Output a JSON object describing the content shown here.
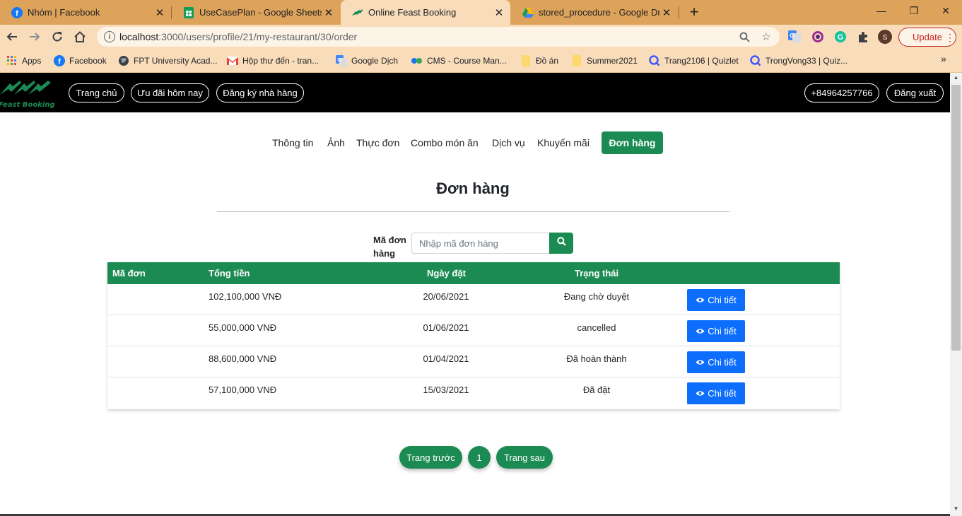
{
  "browser": {
    "tabs": [
      {
        "title": "Nhóm | Facebook",
        "icon": "facebook-icon"
      },
      {
        "title": "UseCasePlan - Google Sheets",
        "icon": "google-sheets-icon"
      },
      {
        "title": "Online Feast Booking",
        "icon": "feast-booking-icon",
        "active": true
      },
      {
        "title": "stored_procedure - Google Drive",
        "icon": "google-drive-icon"
      }
    ],
    "url_host": "localhost",
    "url_path": ":3000/users/profile/21/my-restaurant/30/order",
    "profile_initial": "S",
    "update_label": "Update",
    "bookmarks": [
      {
        "label": "Apps",
        "icon": "apps-grid-icon"
      },
      {
        "label": "Facebook",
        "icon": "facebook-icon"
      },
      {
        "label": "FPT University Acad...",
        "icon": "globe-icon"
      },
      {
        "label": "Hộp thư đến - tran...",
        "icon": "gmail-icon"
      },
      {
        "label": "Google Dịch",
        "icon": "google-translate-icon"
      },
      {
        "label": "CMS - Course Man...",
        "icon": "cms-icon"
      },
      {
        "label": "Đồ án",
        "icon": "folder-icon"
      },
      {
        "label": "Summer2021",
        "icon": "folder-icon"
      },
      {
        "label": "Trang2106 | Quizlet",
        "icon": "quizlet-icon"
      },
      {
        "label": "TrongVong33 | Quiz...",
        "icon": "quizlet-icon"
      }
    ],
    "colors": {
      "tabstrip": "#dea35a",
      "toolbar": "#f9ddbb"
    }
  },
  "site": {
    "logo_text": "Feast Booking",
    "nav": {
      "home": "Trang chủ",
      "deals": "Ưu đãi hôm nay",
      "register": "Đăng ký nhà hàng"
    },
    "phone": "+84964257766",
    "logout": "Đăng xuất",
    "accent_color": "#1b8a53"
  },
  "subnav": {
    "info": "Thông tin",
    "photos": "Ảnh",
    "menu": "Thực đơn",
    "combo": "Combo món ăn",
    "services": "Dịch vụ",
    "promotions": "Khuyến mãi",
    "orders": "Đơn hàng"
  },
  "page": {
    "title": "Đơn hàng",
    "search_label": "Mã đơn hàng",
    "search_placeholder": "Nhập mã đơn hàng"
  },
  "table": {
    "headers": {
      "id": "Mã đơn",
      "total": "Tổng tiền",
      "date": "Ngày đặt",
      "status": "Trạng thái"
    },
    "detail_label": "Chi tiết",
    "rows": [
      {
        "id": "",
        "total": "102,100,000 VNĐ",
        "date": "20/06/2021",
        "status": "Đang chờ duyệt"
      },
      {
        "id": "",
        "total": "55,000,000 VNĐ",
        "date": "01/06/2021",
        "status": "cancelled"
      },
      {
        "id": "",
        "total": "88,600,000 VNĐ",
        "date": "01/04/2021",
        "status": "Đã hoàn thành"
      },
      {
        "id": "",
        "total": "57,100,000 VNĐ",
        "date": "15/03/2021",
        "status": "Đã đặt"
      }
    ]
  },
  "pagination": {
    "prev": "Trang trước",
    "current": "1",
    "next": "Trang sau"
  }
}
